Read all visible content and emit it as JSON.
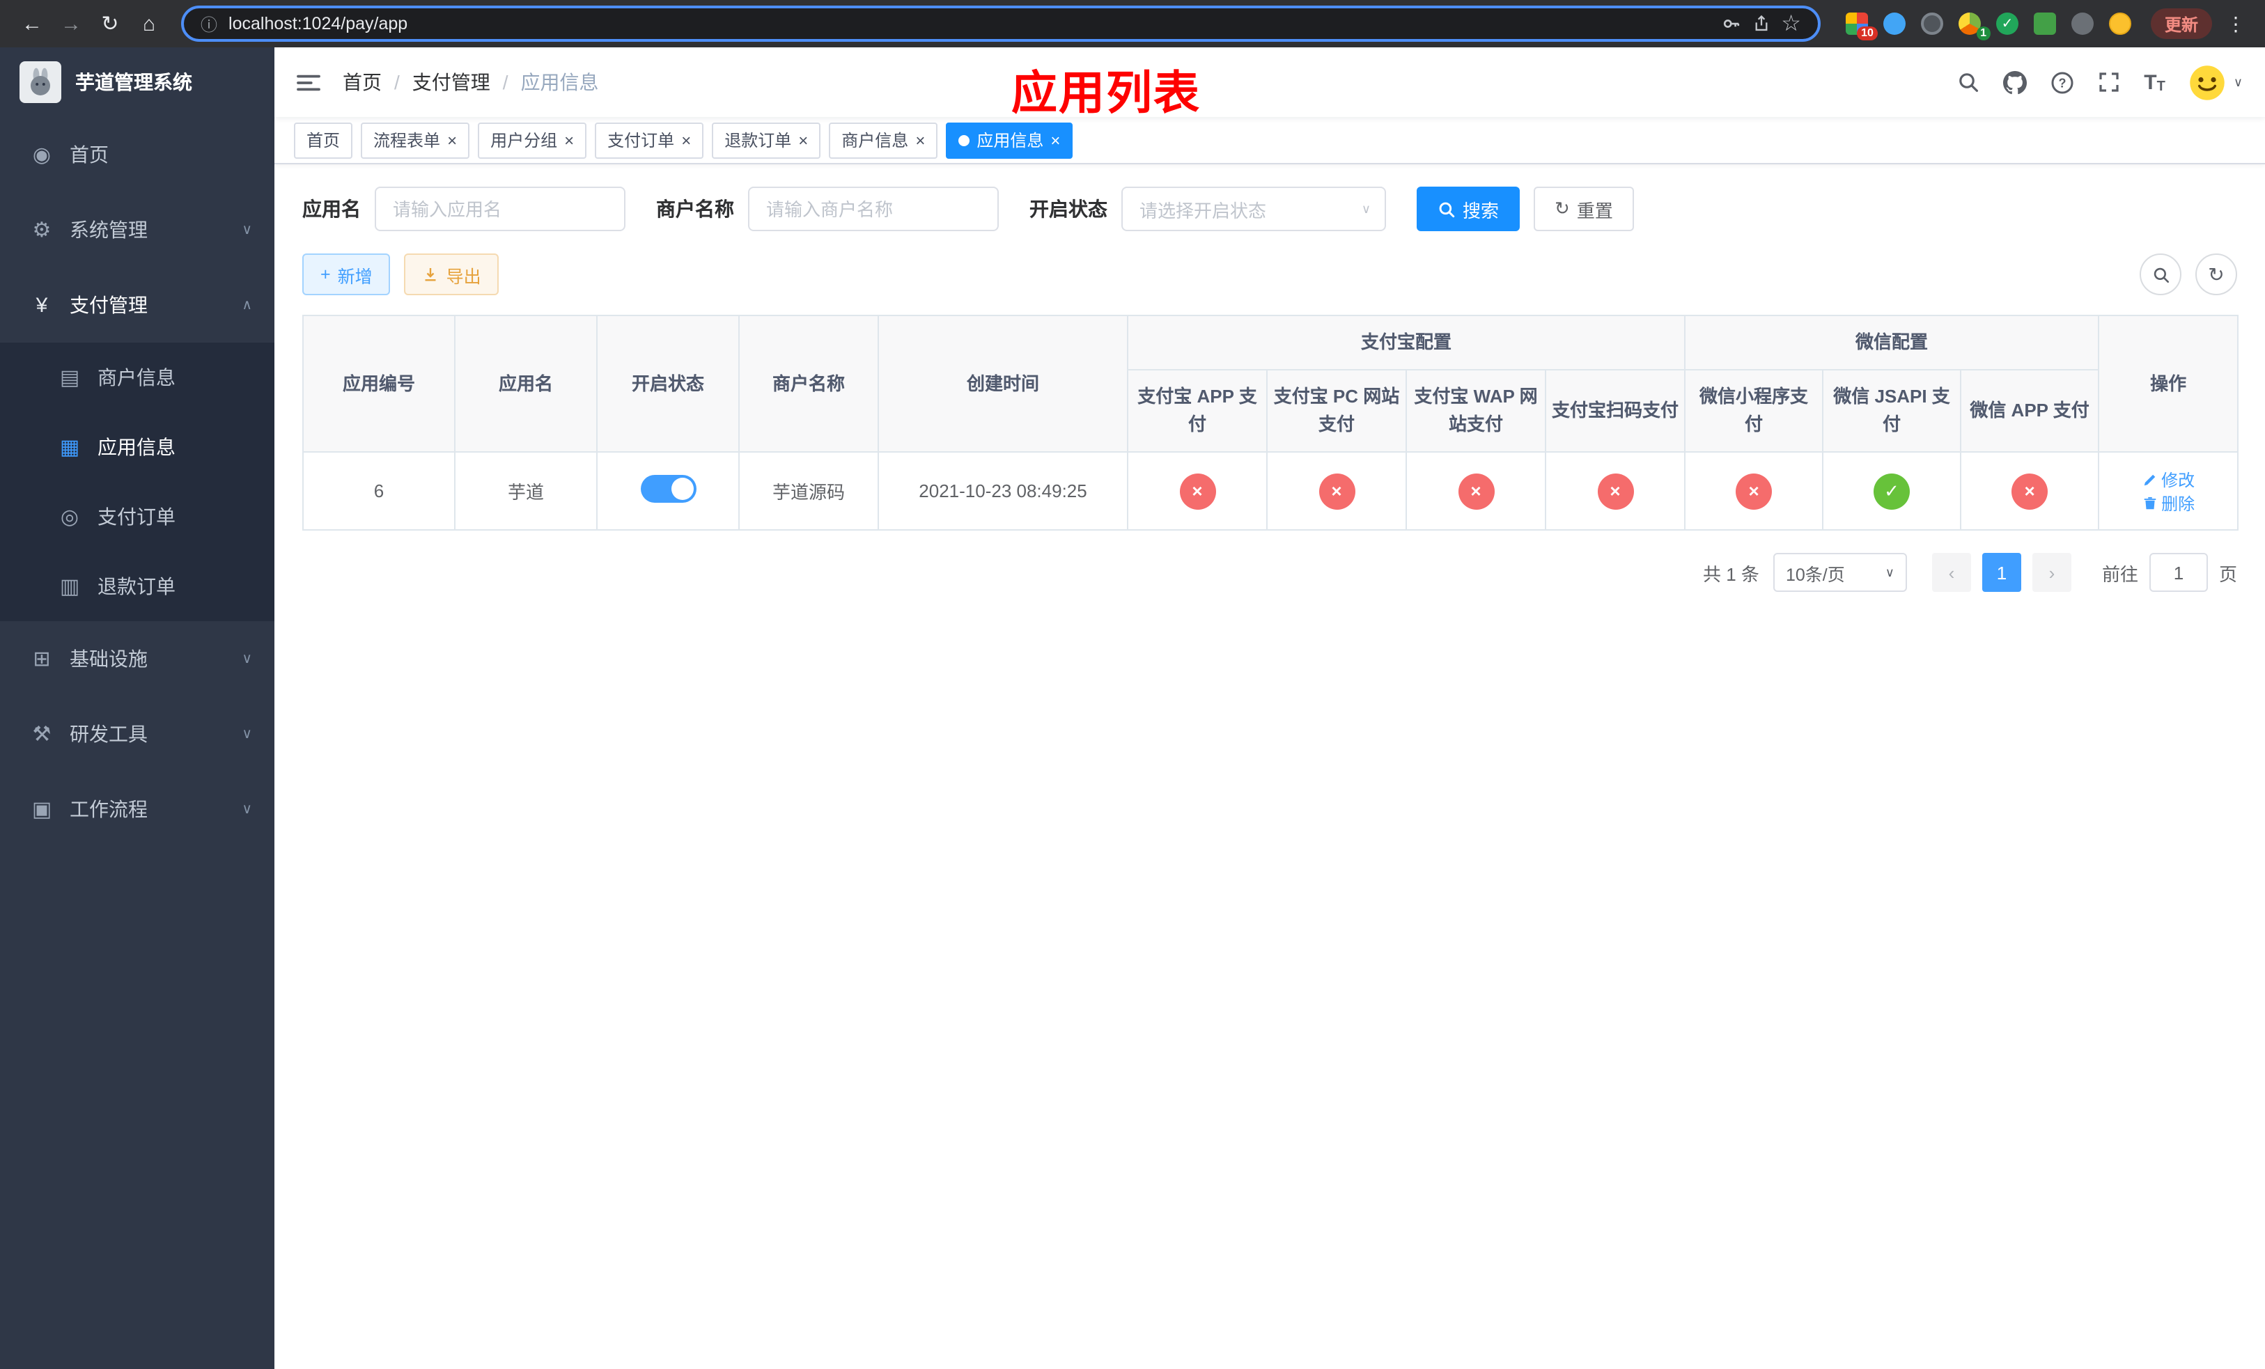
{
  "colors": {
    "accent": "#409eff",
    "tab_active": "#1890ff",
    "success": "#67c23a",
    "danger": "#f56c6c",
    "warning": "#e6a23c",
    "annotation": "#fe0100",
    "sidebar_bg": "#2f3747"
  },
  "symbols": {
    "back": "←",
    "forward": "→",
    "reload": "↻",
    "home": "⌂",
    "info": "ⓘ",
    "star": "☆",
    "menu_dots": "⋮",
    "close": "×",
    "check": "✓",
    "cross": "×",
    "separator": "/",
    "caret_down": "∨",
    "caret_up": "∧",
    "plus": "+",
    "refresh": "↻",
    "prev": "‹",
    "next": "›",
    "text_icon": "T"
  },
  "browser": {
    "url": "localhost:1024/pay/app",
    "update_label": "更新",
    "ext_badge_first": "10",
    "ext_badge_fourth": "1"
  },
  "sidebar": {
    "logo_title": "芋道管理系统",
    "items": [
      {
        "label": "首页",
        "icon": "◉"
      },
      {
        "label": "系统管理",
        "icon": "⚙",
        "chevron": "∨"
      },
      {
        "label": "支付管理",
        "icon": "¥",
        "chevron": "∧"
      },
      {
        "label": "商户信息",
        "icon": "▤"
      },
      {
        "label": "应用信息",
        "icon": "▦"
      },
      {
        "label": "支付订单",
        "icon": "◎"
      },
      {
        "label": "退款订单",
        "icon": "▥"
      },
      {
        "label": "基础设施",
        "icon": "⊞",
        "chevron": "∨"
      },
      {
        "label": "研发工具",
        "icon": "⚒",
        "chevron": "∨"
      },
      {
        "label": "工作流程",
        "icon": "▣",
        "chevron": "∨"
      }
    ]
  },
  "header": {
    "breadcrumb": [
      "首页",
      "支付管理",
      "应用信息"
    ],
    "overlay_title": "应用列表"
  },
  "tabs": [
    {
      "label": "首页"
    },
    {
      "label": "流程表单"
    },
    {
      "label": "用户分组"
    },
    {
      "label": "支付订单"
    },
    {
      "label": "退款订单"
    },
    {
      "label": "商户信息"
    },
    {
      "label": "应用信息"
    }
  ],
  "filters": {
    "app_name_label": "应用名",
    "app_name_placeholder": "请输入应用名",
    "merchant_label": "商户名称",
    "merchant_placeholder": "请输入商户名称",
    "status_label": "开启状态",
    "status_placeholder": "请选择开启状态",
    "search_button": "搜索",
    "reset_button": "重置"
  },
  "toolbar": {
    "add_button": "新增",
    "export_button": "导出"
  },
  "table": {
    "simple_columns": [
      "应用编号",
      "应用名",
      "开启状态",
      "商户名称",
      "创建时间"
    ],
    "groups": [
      {
        "label": "支付宝配置",
        "children": [
          "支付宝 APP 支付",
          "支付宝 PC 网站支付",
          "支付宝 WAP 网站支付",
          "支付宝扫码支付"
        ]
      },
      {
        "label": "微信配置",
        "children": [
          "微信小程序支付",
          "微信 JSAPI 支付",
          "微信 APP 支付"
        ]
      }
    ],
    "action_column": "操作",
    "row": {
      "id": "6",
      "name": "芋道",
      "enabled": true,
      "merchant": "芋道源码",
      "created": "2021-10-23 08:49:25",
      "statuses": [
        "disabled",
        "disabled",
        "disabled",
        "disabled",
        "disabled",
        "enabled",
        "disabled"
      ],
      "edit_label": "修改",
      "delete_label": "删除"
    }
  },
  "pagination": {
    "total_text": "共 1 条",
    "page_size": "10条/页",
    "current_page": "1",
    "goto_label": "前往",
    "goto_value": "1",
    "goto_suffix": "页"
  }
}
